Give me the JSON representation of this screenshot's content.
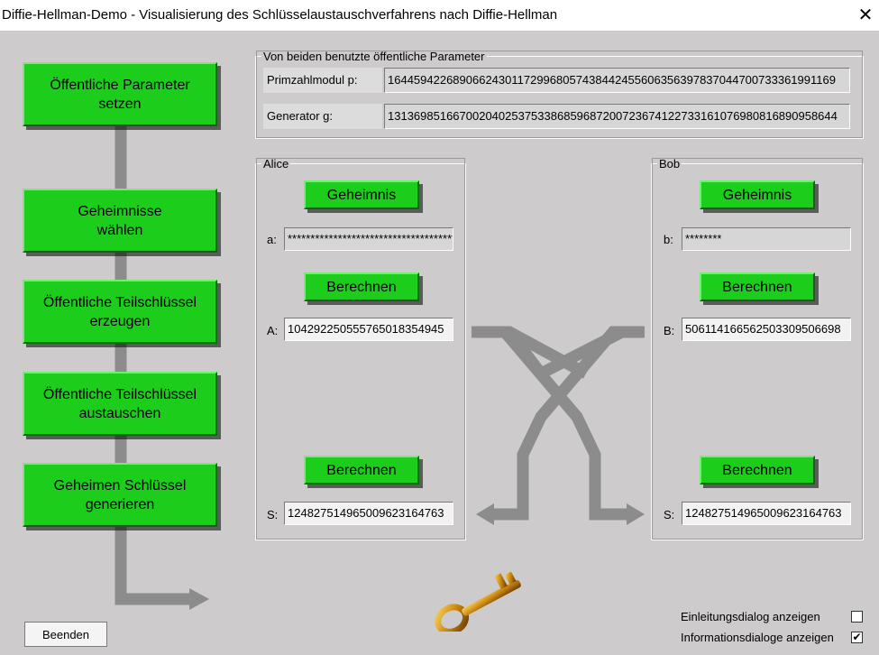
{
  "window": {
    "title": "Diffie-Hellman-Demo - Visualisierung des Schlüsselaustauschverfahrens nach Diffie-Hellman",
    "close_glyph": "✕"
  },
  "steps": [
    {
      "line1": "Öffentliche Parameter",
      "line2": "setzen"
    },
    {
      "line1": "Geheimnisse",
      "line2": "wählen"
    },
    {
      "line1": "Öffentliche Teilschlüssel",
      "line2": "erzeugen"
    },
    {
      "line1": "Öffentliche Teilschlüssel",
      "line2": "austauschen"
    },
    {
      "line1": "Geheimen Schlüssel",
      "line2": "generieren"
    }
  ],
  "params": {
    "legend": "Von beiden benutzte öffentliche Parameter",
    "p_label": "Primzahlmodul p:",
    "p_value": "164459422689066243011729968057438442455606356397837044700733361991169",
    "g_label": "Generator g:",
    "g_value": "131369851667002040253753386859687200723674122733161076980816890958644"
  },
  "alice": {
    "legend": "Alice",
    "secret_button": "Geheimnis",
    "secret_label": "a:",
    "secret_value": "***********************************************",
    "compute_button": "Berechnen",
    "public_label": "A:",
    "public_value": "104292250555765018354945",
    "compute2_button": "Berechnen",
    "shared_label": "S:",
    "shared_value": "124827514965009623164763"
  },
  "bob": {
    "legend": "Bob",
    "secret_button": "Geheimnis",
    "secret_label": "b:",
    "secret_value": "********",
    "compute_button": "Berechnen",
    "public_label": "B:",
    "public_value": "506114166562503309506698",
    "compute2_button": "Berechnen",
    "shared_label": "S:",
    "shared_value": "124827514965009623164763"
  },
  "footer": {
    "exit_button": "Beenden",
    "intro_label": "Einleitungsdialog anzeigen",
    "intro_checked": false,
    "info_label": "Informationsdialoge anzeigen",
    "info_checked": true
  },
  "colors": {
    "button_green": "#1ccd1c",
    "background": "#cdcbcc",
    "arrow": "#8c8c8c",
    "key_gold": "#d4a017"
  }
}
